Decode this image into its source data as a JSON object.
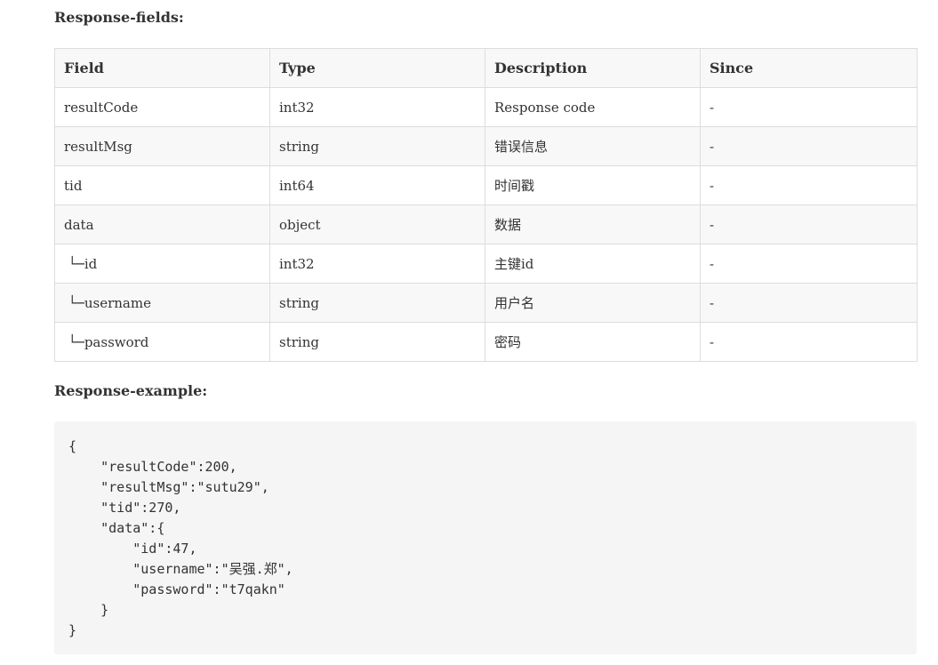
{
  "response_fields": {
    "heading": "Response-fields:",
    "columns": [
      "Field",
      "Type",
      "Description",
      "Since"
    ],
    "rows": [
      [
        "resultCode",
        "int32",
        "Response code",
        "-"
      ],
      [
        "resultMsg",
        "string",
        "错误信息",
        "-"
      ],
      [
        "tid",
        "int64",
        "时间戳",
        "-"
      ],
      [
        "data",
        "object",
        "数据",
        "-"
      ],
      [
        " └─id",
        "int32",
        "主键id",
        "-"
      ],
      [
        " └─username",
        "string",
        "用户名",
        "-"
      ],
      [
        " └─password",
        "string",
        "密码",
        "-"
      ]
    ]
  },
  "response_example": {
    "heading": "Response-example:",
    "code": "{\n    \"resultCode\":200,\n    \"resultMsg\":\"sutu29\",\n    \"tid\":270,\n    \"data\":{\n        \"id\":47,\n        \"username\":\"吴强.郑\",\n        \"password\":\"t7qakn\"\n    }\n}"
  }
}
